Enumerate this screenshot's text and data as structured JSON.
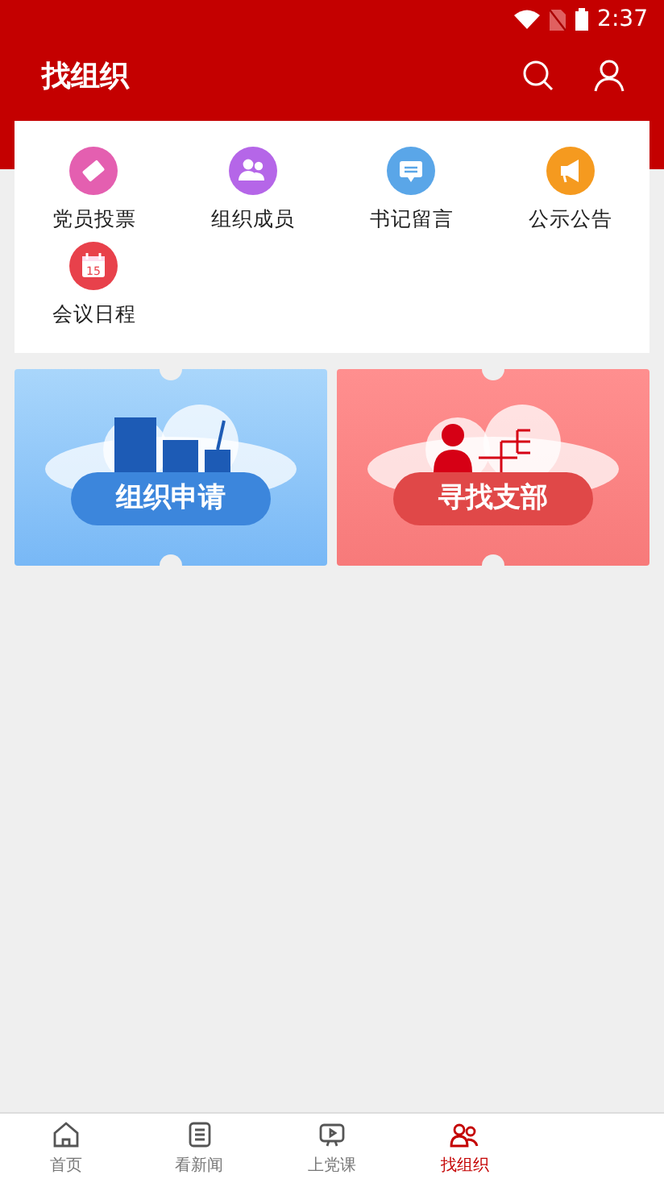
{
  "status_bar": {
    "time": "2:37"
  },
  "header": {
    "title": "找组织"
  },
  "shortcuts": [
    {
      "label": "党员投票",
      "kind": "ticket",
      "color": "#e45fb0"
    },
    {
      "label": "组织成员",
      "kind": "people",
      "color": "#b566e8"
    },
    {
      "label": "书记留言",
      "kind": "message",
      "color": "#5aa6e8"
    },
    {
      "label": "公示公告",
      "kind": "megaphone",
      "color": "#f59a1f"
    },
    {
      "label": "会议日程",
      "kind": "calendar",
      "color": "#e8414b",
      "icon_text": "15"
    }
  ],
  "banners": [
    {
      "label": "组织申请",
      "kind": "apply"
    },
    {
      "label": "寻找支部",
      "kind": "branch"
    }
  ],
  "tabs": [
    {
      "label": "首页",
      "kind": "home",
      "selected": false
    },
    {
      "label": "看新闻",
      "kind": "news",
      "selected": false
    },
    {
      "label": "上党课",
      "kind": "video",
      "selected": false
    },
    {
      "label": "找组织",
      "kind": "org",
      "selected": true
    }
  ]
}
